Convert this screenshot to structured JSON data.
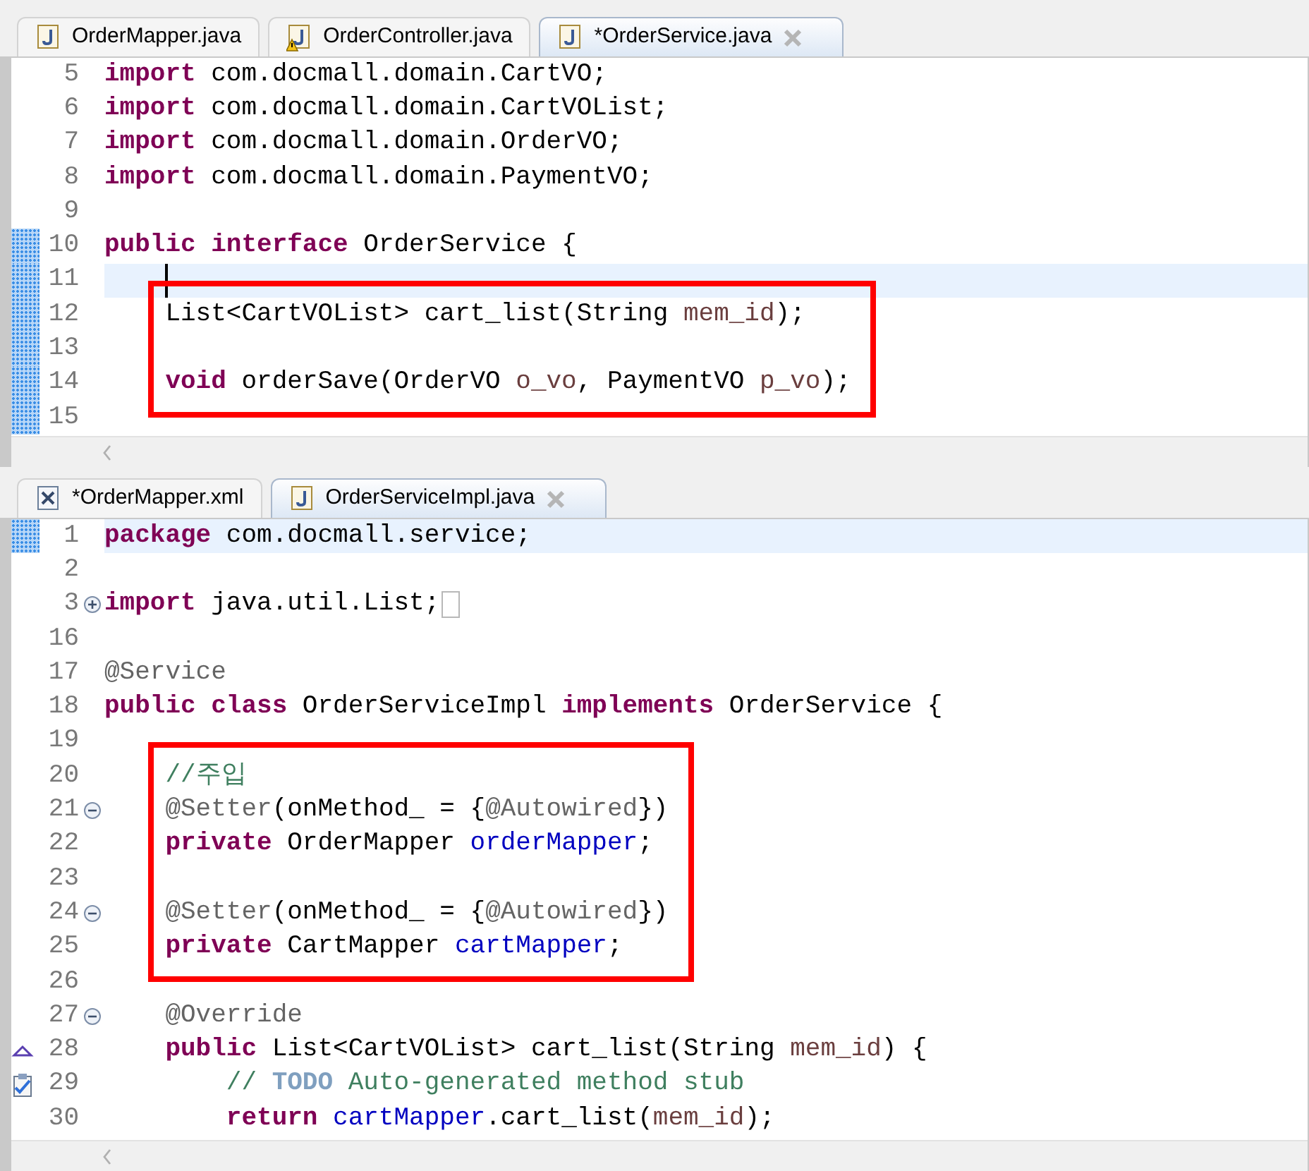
{
  "top_editor": {
    "focused": true,
    "tabs": [
      {
        "label": "OrderMapper.java",
        "kind": "java",
        "selected": false,
        "warning": false
      },
      {
        "label": "OrderController.java",
        "kind": "java",
        "selected": false,
        "warning": true
      },
      {
        "label": "*OrderService.java",
        "kind": "java",
        "selected": true,
        "warning": false
      }
    ],
    "blocks": [
      {
        "boxed": false,
        "lines": [
          {
            "number": "5",
            "current": false,
            "tokens": [
              {
                "kind": "keyword",
                "text": "import"
              },
              {
                "kind": "plain",
                "text": " com.docmall.domain.CartVO;"
              }
            ]
          },
          {
            "number": "6",
            "current": false,
            "tokens": [
              {
                "kind": "keyword",
                "text": "import"
              },
              {
                "kind": "plain",
                "text": " com.docmall.domain.CartVOList;"
              }
            ]
          },
          {
            "number": "7",
            "current": false,
            "tokens": [
              {
                "kind": "keyword",
                "text": "import"
              },
              {
                "kind": "plain",
                "text": " com.docmall.domain.OrderVO;"
              }
            ]
          },
          {
            "number": "8",
            "current": false,
            "tokens": [
              {
                "kind": "keyword",
                "text": "import"
              },
              {
                "kind": "plain",
                "text": " com.docmall.domain.PaymentVO;"
              }
            ]
          },
          {
            "number": "9",
            "current": false
          },
          {
            "number": "10",
            "current": false,
            "marker": {
              "kind": "change"
            },
            "tokens": [
              {
                "kind": "keyword",
                "text": "public"
              },
              {
                "kind": "keyword",
                "text": " interface"
              },
              {
                "kind": "plain",
                "text": " OrderService {"
              }
            ]
          },
          {
            "number": "11",
            "current": true,
            "marker": {
              "kind": "change"
            }
          }
        ]
      },
      {
        "boxed": true,
        "lines": [
          {
            "number": "12",
            "current": false,
            "marker": {
              "kind": "change"
            },
            "tokens": [
              {
                "kind": "plain",
                "text": "    List<CartVOList> cart_list(String "
              },
              {
                "kind": "param",
                "text": "mem_id"
              },
              {
                "kind": "plain",
                "text": ");"
              }
            ]
          },
          {
            "number": "13",
            "current": false,
            "marker": {
              "kind": "change"
            }
          },
          {
            "number": "14",
            "current": false,
            "marker": {
              "kind": "change"
            },
            "tokens": [
              {
                "kind": "keyword",
                "text": "    void"
              },
              {
                "kind": "plain",
                "text": " orderSave(OrderVO "
              },
              {
                "kind": "param",
                "text": "o_vo"
              },
              {
                "kind": "plain",
                "text": ", PaymentVO "
              },
              {
                "kind": "param",
                "text": "p_vo"
              },
              {
                "kind": "plain",
                "text": ");"
              }
            ]
          }
        ]
      },
      {
        "boxed": false,
        "lines": [
          {
            "number": "15",
            "current": false,
            "marker": {
              "kind": "change"
            }
          }
        ]
      }
    ]
  },
  "bottom_editor": {
    "focused": false,
    "tabs": [
      {
        "label": "*OrderMapper.xml",
        "kind": "xml",
        "selected": false,
        "warning": false
      },
      {
        "label": "OrderServiceImpl.java",
        "kind": "java",
        "selected": true,
        "warning": false
      }
    ],
    "blocks": [
      {
        "boxed": false,
        "lines": [
          {
            "number": "1",
            "current": true,
            "marker": {
              "kind": "change"
            },
            "tokens": [
              {
                "kind": "keyword",
                "text": "package"
              },
              {
                "kind": "plain",
                "text": " com.docmall.service;"
              }
            ]
          },
          {
            "number": "2",
            "current": false
          },
          {
            "number": "3",
            "current": false,
            "fold": {
              "expanded": false
            },
            "tokens": [
              {
                "kind": "keyword",
                "text": "import"
              },
              {
                "kind": "plain",
                "text": " java.util.List;"
              }
            ]
          },
          {
            "number": "16",
            "current": false
          },
          {
            "number": "17",
            "current": false,
            "tokens": [
              {
                "kind": "annotation",
                "text": "@Service"
              }
            ]
          },
          {
            "number": "18",
            "current": false,
            "tokens": [
              {
                "kind": "keyword",
                "text": "public"
              },
              {
                "kind": "keyword",
                "text": " class"
              },
              {
                "kind": "plain",
                "text": " OrderServiceImpl "
              },
              {
                "kind": "keyword",
                "text": "implements"
              },
              {
                "kind": "plain",
                "text": " OrderService {"
              }
            ]
          },
          {
            "number": "19",
            "current": false
          }
        ]
      },
      {
        "boxed": true,
        "lines": [
          {
            "number": "20",
            "current": false,
            "tokens": [
              {
                "kind": "comment",
                "text": "    //주입"
              }
            ]
          },
          {
            "number": "21",
            "current": false,
            "fold": {
              "expanded": true
            },
            "tokens": [
              {
                "kind": "annotation",
                "text": "    @Setter"
              },
              {
                "kind": "plain",
                "text": "(onMethod_ = {"
              },
              {
                "kind": "annotation",
                "text": "@Autowired"
              },
              {
                "kind": "plain",
                "text": "})"
              }
            ]
          },
          {
            "number": "22",
            "current": false,
            "tokens": [
              {
                "kind": "keyword",
                "text": "    private"
              },
              {
                "kind": "plain",
                "text": " OrderMapper "
              },
              {
                "kind": "field",
                "text": "orderMapper"
              },
              {
                "kind": "plain",
                "text": ";"
              }
            ]
          },
          {
            "number": "23",
            "current": false
          },
          {
            "number": "24",
            "current": false,
            "fold": {
              "expanded": true
            },
            "tokens": [
              {
                "kind": "annotation",
                "text": "    @Setter"
              },
              {
                "kind": "plain",
                "text": "(onMethod_ = {"
              },
              {
                "kind": "annotation",
                "text": "@Autowired"
              },
              {
                "kind": "plain",
                "text": "})"
              }
            ]
          },
          {
            "number": "25",
            "current": false,
            "tokens": [
              {
                "kind": "keyword",
                "text": "    private"
              },
              {
                "kind": "plain",
                "text": " CartMapper "
              },
              {
                "kind": "field",
                "text": "cartMapper"
              },
              {
                "kind": "plain",
                "text": ";"
              }
            ]
          }
        ]
      },
      {
        "boxed": false,
        "lines": [
          {
            "number": "26",
            "current": false
          },
          {
            "number": "27",
            "current": false,
            "fold": {
              "expanded": true
            },
            "tokens": [
              {
                "kind": "annotation",
                "text": "    @Override"
              }
            ]
          },
          {
            "number": "28",
            "current": false,
            "marker": {
              "kind": "override"
            },
            "tokens": [
              {
                "kind": "keyword",
                "text": "    public"
              },
              {
                "kind": "plain",
                "text": " List<CartVOList> cart_list(String "
              },
              {
                "kind": "param",
                "text": "mem_id"
              },
              {
                "kind": "plain",
                "text": ") {"
              }
            ]
          },
          {
            "number": "29",
            "current": false,
            "marker": {
              "kind": "task"
            },
            "tokens": [
              {
                "kind": "comment",
                "text": "        // "
              },
              {
                "kind": "todo",
                "text": "TODO"
              },
              {
                "kind": "comment",
                "text": " Auto-generated method stub"
              }
            ]
          },
          {
            "number": "30",
            "current": false,
            "tokens": [
              {
                "kind": "keyword",
                "text": "        return "
              },
              {
                "kind": "field",
                "text": "cartMapper"
              },
              {
                "kind": "plain",
                "text": ".cart_list("
              },
              {
                "kind": "param",
                "text": "mem_id"
              },
              {
                "kind": "plain",
                "text": ");"
              }
            ]
          }
        ]
      }
    ]
  }
}
